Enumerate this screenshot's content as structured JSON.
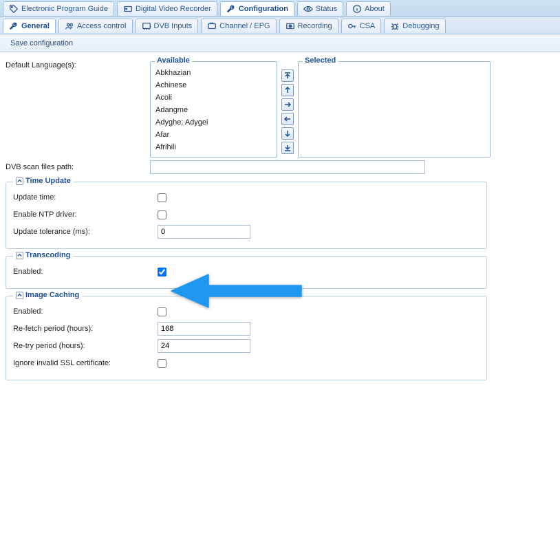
{
  "top_tabs": [
    {
      "icon": "tag-icon",
      "label": "Electronic Program Guide"
    },
    {
      "icon": "dvr-icon",
      "label": "Digital Video Recorder"
    },
    {
      "icon": "wrench-icon",
      "label": "Configuration"
    },
    {
      "icon": "eye-icon",
      "label": "Status"
    },
    {
      "icon": "info-icon",
      "label": "About"
    }
  ],
  "top_tabs_active": 2,
  "sub_tabs": [
    {
      "icon": "wrench-icon",
      "label": "General"
    },
    {
      "icon": "users-icon",
      "label": "Access control"
    },
    {
      "icon": "card-icon",
      "label": "DVB Inputs"
    },
    {
      "icon": "tv-icon",
      "label": "Channel / EPG"
    },
    {
      "icon": "rec-icon",
      "label": "Recording"
    },
    {
      "icon": "key-icon",
      "label": "CSA"
    },
    {
      "icon": "bug-icon",
      "label": "Debugging"
    }
  ],
  "sub_tabs_active": 0,
  "toolbar": {
    "save_label": "Save configuration"
  },
  "form": {
    "default_lang_label": "Default Language(s):",
    "langs_available_legend": "Available",
    "langs_selected_legend": "Selected",
    "langs_available": [
      "Abkhazian",
      "Achinese",
      "Acoli",
      "Adangme",
      "Adyghe; Adygei",
      "Afar",
      "Afrihili"
    ],
    "langs_selected": [],
    "dvb_scan_label": "DVB scan files path:",
    "dvb_scan_value": ""
  },
  "group_time": {
    "legend": "Time Update",
    "update_time_label": "Update time:",
    "update_time_checked": false,
    "enable_ntp_label": "Enable NTP driver:",
    "enable_ntp_checked": false,
    "tolerance_label": "Update tolerance (ms):",
    "tolerance_value": "0"
  },
  "group_transcoding": {
    "legend": "Transcoding",
    "enabled_label": "Enabled:",
    "enabled_checked": true
  },
  "group_imagecache": {
    "legend": "Image Caching",
    "enabled_label": "Enabled:",
    "enabled_checked": false,
    "refetch_label": "Re-fetch period (hours):",
    "refetch_value": "168",
    "retry_label": "Re-try period (hours):",
    "retry_value": "24",
    "ignore_ssl_label": "Ignore invalid SSL certificate:",
    "ignore_ssl_checked": false
  }
}
